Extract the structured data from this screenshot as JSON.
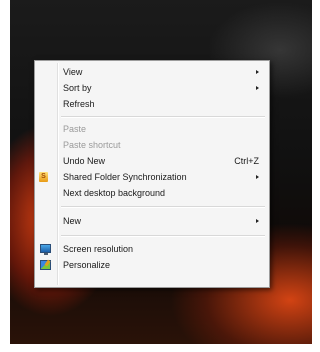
{
  "menu": {
    "items": [
      {
        "label": "View",
        "submenu": true
      },
      {
        "label": "Sort by",
        "submenu": true
      },
      {
        "label": "Refresh"
      },
      {
        "label": "Paste",
        "disabled": true
      },
      {
        "label": "Paste shortcut",
        "disabled": true
      },
      {
        "label": "Undo New",
        "shortcut": "Ctrl+Z"
      },
      {
        "label": "Shared Folder Synchronization",
        "submenu": true,
        "icon": "sync-folder-icon"
      },
      {
        "label": "Next desktop background"
      },
      {
        "label": "New",
        "submenu": true
      },
      {
        "label": "Screen resolution",
        "icon": "screen-resolution-icon"
      },
      {
        "label": "Personalize",
        "icon": "personalize-icon"
      }
    ]
  },
  "icons": {
    "sync_glyph": "S"
  }
}
